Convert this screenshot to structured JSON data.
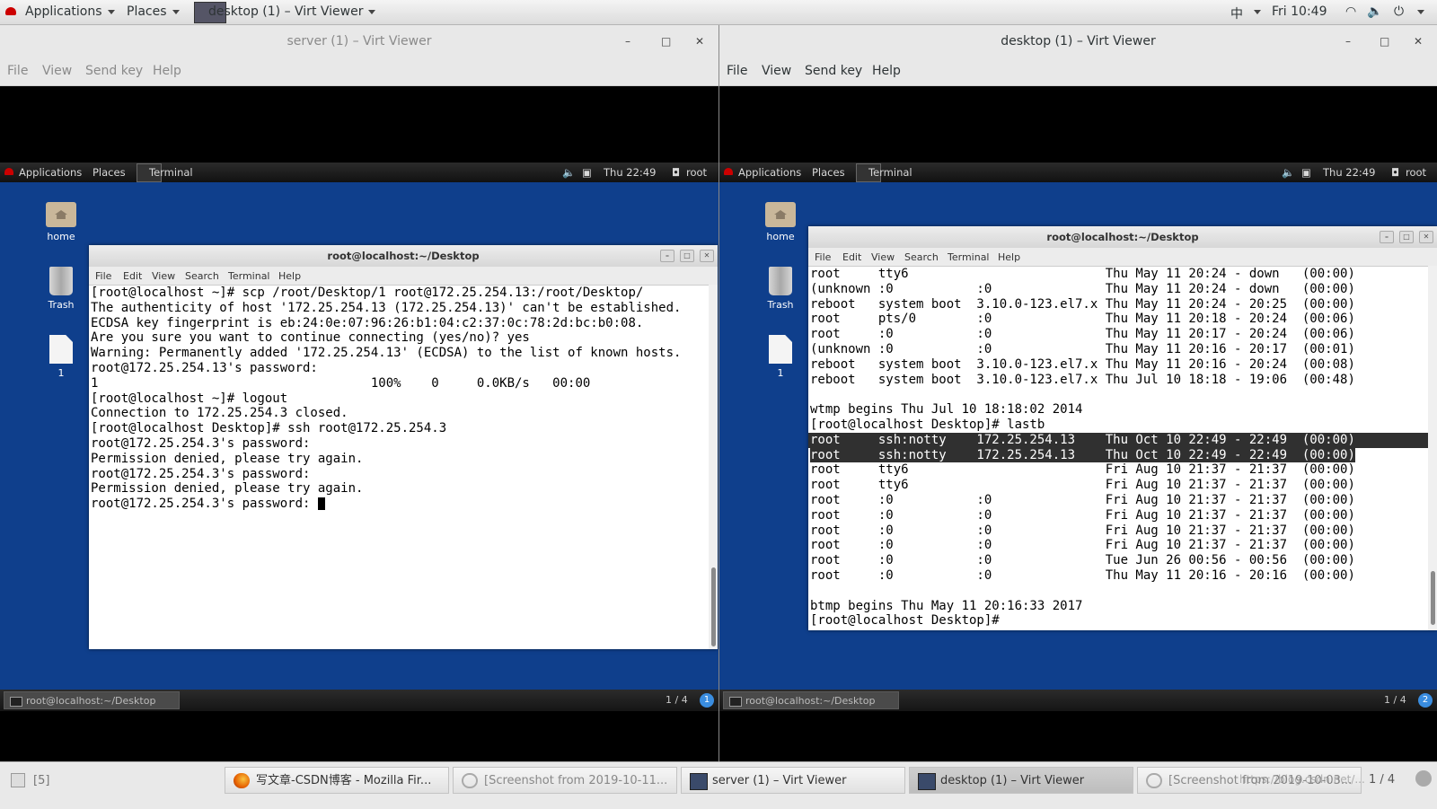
{
  "host_topbar": {
    "applications": "Applications",
    "places": "Places",
    "active_window": "desktop (1) – Virt Viewer",
    "input_method": "中",
    "clock": "Fri 10:49"
  },
  "viewer_menu": [
    "File",
    "View",
    "Send key",
    "Help"
  ],
  "viewers": [
    {
      "title": "server (1) – Virt Viewer",
      "guest": {
        "applications": "Applications",
        "places": "Places",
        "terminal": "Terminal",
        "clock": "Thu 22:49",
        "user": "root",
        "desktop_icons": [
          "home",
          "Trash",
          "1"
        ],
        "terminal_title": "root@localhost:~/Desktop",
        "terminal_menu": [
          "File",
          "Edit",
          "View",
          "Search",
          "Terminal",
          "Help"
        ],
        "lines": [
          "[root@localhost ~]# scp /root/Desktop/1 root@172.25.254.13:/root/Desktop/",
          "The authenticity of host '172.25.254.13 (172.25.254.13)' can't be established.",
          "ECDSA key fingerprint is eb:24:0e:07:96:26:b1:04:c2:37:0c:78:2d:bc:b0:08.",
          "Are you sure you want to continue connecting (yes/no)? yes",
          "Warning: Permanently added '172.25.254.13' (ECDSA) to the list of known hosts.",
          "root@172.25.254.13's password:",
          "1                                    100%    0     0.0KB/s   00:00",
          "[root@localhost ~]# logout",
          "Connection to 172.25.254.3 closed.",
          "[root@localhost Desktop]# ssh root@172.25.254.3",
          "root@172.25.254.3's password:",
          "Permission denied, please try again.",
          "root@172.25.254.3's password:",
          "Permission denied, please try again.",
          "root@172.25.254.3's password: "
        ],
        "taskbar_item": "root@localhost:~/Desktop",
        "workspace": "1 / 4",
        "info_badge": "1"
      }
    },
    {
      "title": "desktop (1) – Virt Viewer",
      "guest": {
        "applications": "Applications",
        "places": "Places",
        "terminal": "Terminal",
        "clock": "Thu 22:49",
        "user": "root",
        "desktop_icons": [
          "home",
          "Trash",
          "1"
        ],
        "terminal_title": "root@localhost:~/Desktop",
        "terminal_menu": [
          "File",
          "Edit",
          "View",
          "Search",
          "Terminal",
          "Help"
        ],
        "lines": [
          "root     tty6                          Thu May 11 20:24 - down   (00:00)",
          "(unknown :0           :0               Thu May 11 20:24 - down   (00:00)",
          "reboot   system boot  3.10.0-123.el7.x Thu May 11 20:24 - 20:25  (00:00)",
          "root     pts/0        :0               Thu May 11 20:18 - 20:24  (00:06)",
          "root     :0           :0               Thu May 11 20:17 - 20:24  (00:06)",
          "(unknown :0           :0               Thu May 11 20:16 - 20:17  (00:01)",
          "reboot   system boot  3.10.0-123.el7.x Thu May 11 20:16 - 20:24  (00:08)",
          "reboot   system boot  3.10.0-123.el7.x Thu Jul 10 18:18 - 19:06  (00:48)",
          "",
          "wtmp begins Thu Jul 10 18:18:02 2014",
          "[root@localhost Desktop]# lastb",
          "root     ssh:notty    172.25.254.13    Thu Oct 10 22:49 - 22:49  (00:00)",
          "root     ssh:notty    172.25.254.13    Thu Oct 10 22:49 - 22:49  (00:00)",
          "root     tty6                          Fri Aug 10 21:37 - 21:37  (00:00)",
          "root     tty6                          Fri Aug 10 21:37 - 21:37  (00:00)",
          "root     :0           :0               Fri Aug 10 21:37 - 21:37  (00:00)",
          "root     :0           :0               Fri Aug 10 21:37 - 21:37  (00:00)",
          "root     :0           :0               Fri Aug 10 21:37 - 21:37  (00:00)",
          "root     :0           :0               Fri Aug 10 21:37 - 21:37  (00:00)",
          "root     :0           :0               Tue Jun 26 00:56 - 00:56  (00:00)",
          "root     :0           :0               Thu May 11 20:16 - 20:16  (00:00)",
          "",
          "btmp begins Thu May 11 20:16:33 2017",
          "[root@localhost Desktop]#"
        ],
        "taskbar_item": "root@localhost:~/Desktop",
        "workspace": "1 / 4",
        "info_badge": "2"
      }
    }
  ],
  "host_taskbar": {
    "items": [
      "[5]",
      "写文章-CSDN博客 - Mozilla Fir...",
      "[Screenshot from 2019-10-11...",
      "server (1) – Virt Viewer",
      "desktop (1) – Virt Viewer",
      "[Screenshot from 2019-10-03..."
    ],
    "workspace": "1 / 4",
    "watermark": "https://blog.csdn.net/..."
  }
}
